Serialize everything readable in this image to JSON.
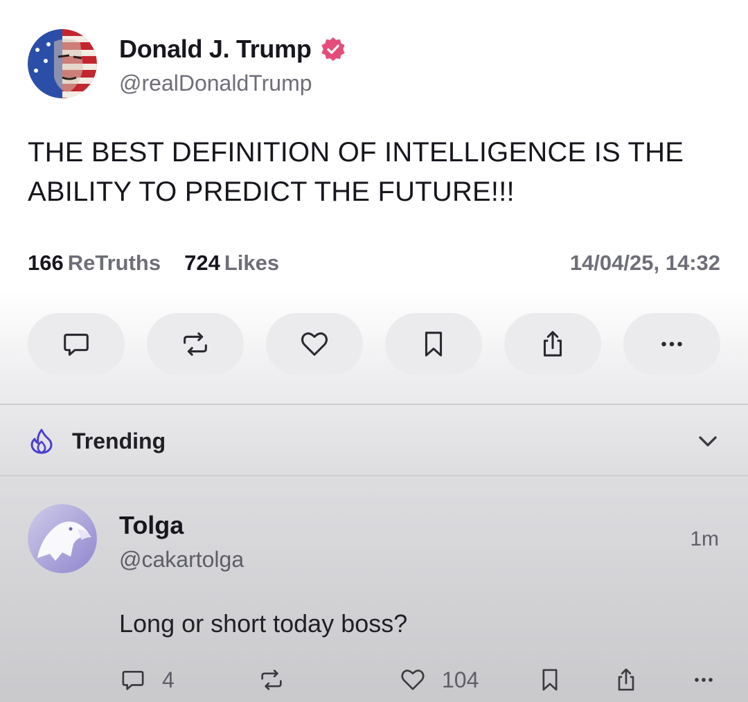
{
  "post": {
    "author": {
      "name": "Donald J. Trump",
      "handle": "@realDonaldTrump",
      "verified_color": "#e64c79"
    },
    "text": "THE BEST DEFINITION OF INTELLIGENCE IS THE ABILITY TO PREDICT THE FUTURE!!!",
    "stats": {
      "retruths_count": "166",
      "retruths_label": "ReTruths",
      "likes_count": "724",
      "likes_label": "Likes"
    },
    "timestamp": "14/04/25, 14:32",
    "actions": [
      "comment-icon",
      "retruth-icon",
      "heart-icon",
      "bookmark-icon",
      "share-icon",
      "more-icon"
    ]
  },
  "trending": {
    "label": "Trending",
    "accent_color": "#4a3fd0"
  },
  "reply": {
    "name": "Tolga",
    "handle": "@cakartolga",
    "time": "1m",
    "text": "Long or short today boss?",
    "comments": "4",
    "likes": "104"
  }
}
